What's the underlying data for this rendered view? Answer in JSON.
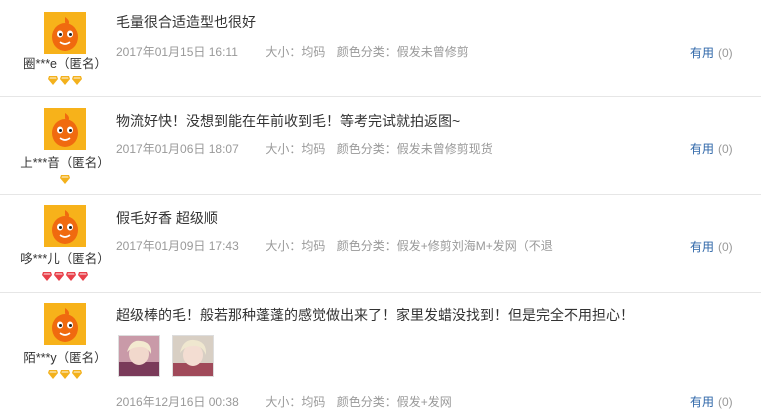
{
  "reviews": [
    {
      "user": "圈***e（匿名）",
      "badge_count": 3,
      "badge_color": "#f3b11c",
      "text": "毛量很合适造型也很好",
      "date": "2017年01月15日 16:11",
      "size": "大小：均码",
      "color": "颜色分类：假发未曾修剪",
      "useful_label": "有用",
      "useful_count": "(0)"
    },
    {
      "user": "上***音（匿名）",
      "badge_count": 1,
      "badge_color": "#f3b11c",
      "text": "物流好快！没想到能在年前收到毛！等考完试就拍返图~",
      "date": "2017年01月06日 18:07",
      "size": "大小：均码",
      "color": "颜色分类：假发未曾修剪现货",
      "useful_label": "有用",
      "useful_count": "(0)"
    },
    {
      "user": "哆***儿（匿名）",
      "badge_count": 4,
      "badge_color": "#e8404a",
      "text": "假毛好香 超级顺",
      "date": "2017年01月09日 17:43",
      "size": "大小：均码",
      "color": "颜色分类：假发+修剪刘海M+发网（不退",
      "useful_label": "有用",
      "useful_count": "(0)"
    },
    {
      "user": "陌***y（匿名）",
      "badge_count": 3,
      "badge_color": "#f3b11c",
      "text": "超级棒的毛！般若那种蓬蓬的感觉做出来了！家里发蜡没找到！但是完全不用担心！",
      "date": "2016年12月16日 00:38",
      "size": "大小：均码",
      "color": "颜色分类：假发+发网",
      "useful_label": "有用",
      "useful_count": "(0)"
    }
  ]
}
